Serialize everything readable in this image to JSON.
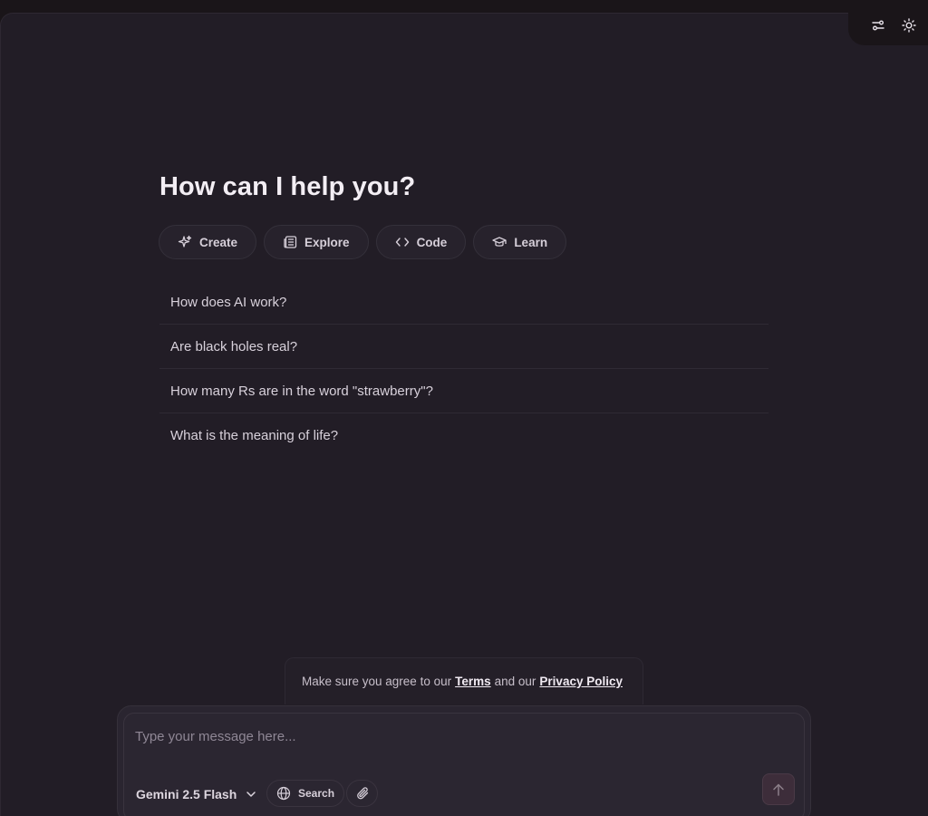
{
  "header": {
    "settings_icon": "sliders-icon",
    "theme_icon": "sun-icon"
  },
  "main": {
    "title": "How can I help you?",
    "categories": [
      {
        "label": "Create",
        "icon": "sparkles-icon"
      },
      {
        "label": "Explore",
        "icon": "newspaper-icon"
      },
      {
        "label": "Code",
        "icon": "code-icon"
      },
      {
        "label": "Learn",
        "icon": "graduation-cap-icon"
      }
    ],
    "suggestions": [
      "How does AI work?",
      "Are black holes real?",
      "How many Rs are in the word \"strawberry\"?",
      "What is the meaning of life?"
    ]
  },
  "notice": {
    "prefix": "Make sure you agree to our",
    "terms": "Terms",
    "middle": "and our",
    "privacy": "Privacy Policy"
  },
  "composer": {
    "placeholder": "Type your message here...",
    "value": "",
    "model": "Gemini 2.5 Flash",
    "search_label": "Search"
  },
  "colors": {
    "background": "#1a1519",
    "panel": "#221d26",
    "send_button": "#3d2d3a"
  }
}
